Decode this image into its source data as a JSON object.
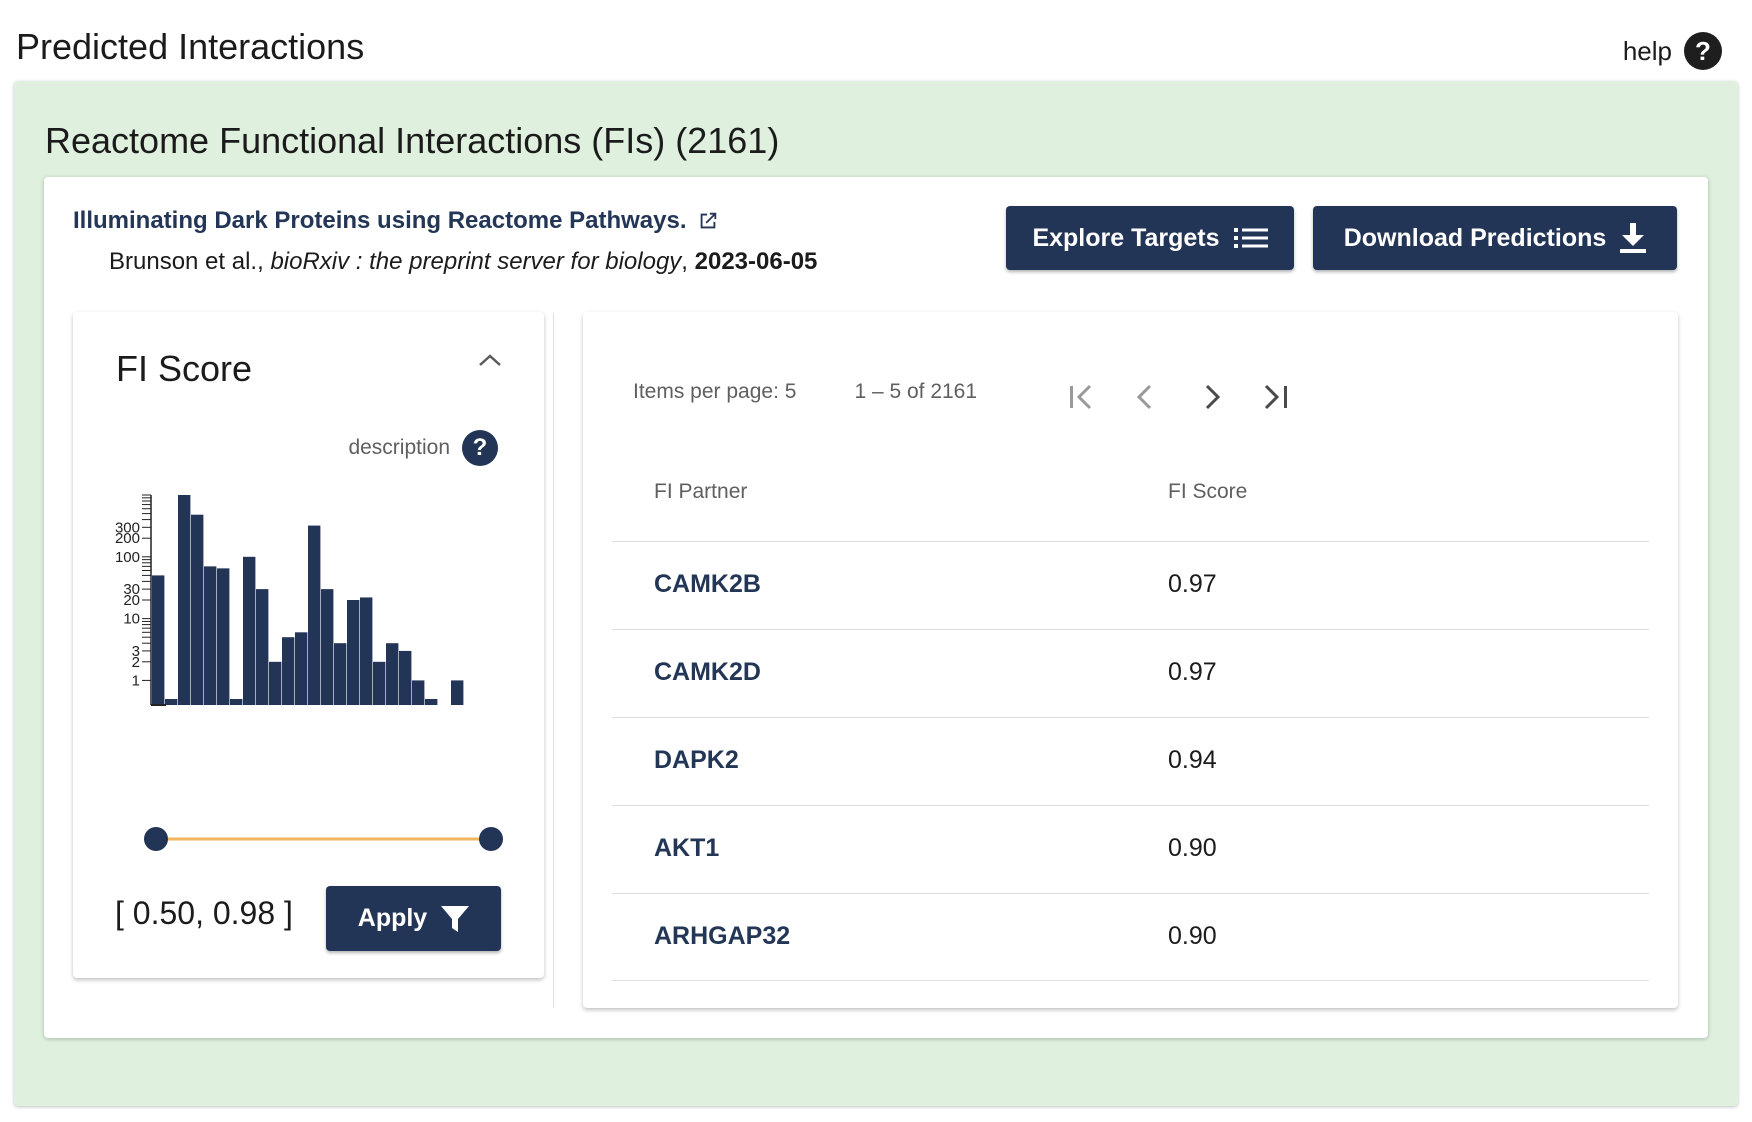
{
  "header": {
    "title": "Predicted Interactions",
    "help_label": "help"
  },
  "section": {
    "title": "Reactome Functional Interactions (FIs) (2161)"
  },
  "publication": {
    "title": "Illuminating Dark Proteins using Reactome Pathways.",
    "authors": "Brunson et al., ",
    "journal": "bioRxiv : the preprint server for biology",
    "separator": ", ",
    "date": "2023-06-05"
  },
  "actions": {
    "explore_label": "Explore Targets",
    "download_label": "Download Predictions"
  },
  "filter": {
    "title": "FI Score",
    "description_label": "description",
    "range_text": "[ 0.50, 0.98 ]",
    "apply_label": "Apply",
    "slider_min": 0.5,
    "slider_max": 0.98,
    "accent_color": "#f0b55e",
    "navy_color": "#233556"
  },
  "chart_data": {
    "type": "bar",
    "scale": "log",
    "ytick_labels": [
      "1",
      "2",
      "3",
      "10",
      "20",
      "30",
      "100",
      "200",
      "300"
    ],
    "yticks": [
      1,
      2,
      3,
      10,
      20,
      30,
      100,
      200,
      300
    ],
    "values": [
      50,
      0.5,
      1000,
      480,
      70,
      65,
      0.5,
      100,
      30,
      2,
      5,
      6,
      320,
      30,
      4,
      20,
      22,
      2,
      4,
      3,
      1,
      0.5,
      0,
      1
    ]
  },
  "table": {
    "items_per_page_label": "Items per page: 5",
    "range_label": "1 – 5 of 2161",
    "columns": [
      "FI Partner",
      "FI Score"
    ],
    "rows": [
      {
        "partner": "CAMK2B",
        "score": "0.97"
      },
      {
        "partner": "CAMK2D",
        "score": "0.97"
      },
      {
        "partner": "DAPK2",
        "score": "0.94"
      },
      {
        "partner": "AKT1",
        "score": "0.90"
      },
      {
        "partner": "ARHGAP32",
        "score": "0.90"
      }
    ]
  }
}
